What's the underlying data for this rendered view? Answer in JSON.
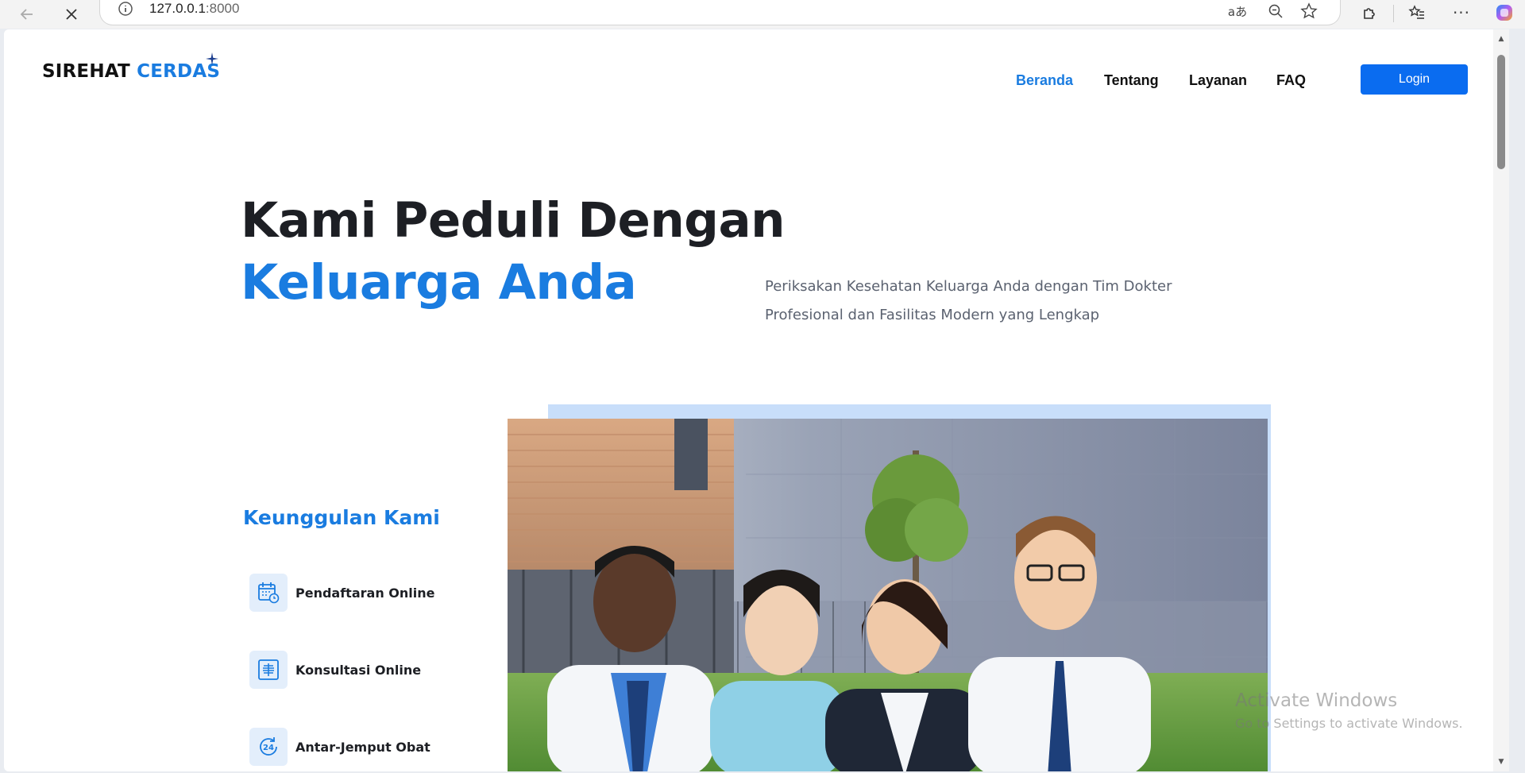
{
  "browser": {
    "url_host": "127.0.0.1",
    "url_port": ":8000"
  },
  "header": {
    "brand_part1": "SIREHAT",
    "brand_part2": "CERDAS",
    "nav": [
      "Beranda",
      "Tentang",
      "Layanan",
      "FAQ"
    ],
    "login_label": "Login"
  },
  "hero": {
    "line1": "Kami Peduli Dengan",
    "line2": "Keluarga Anda",
    "description_line1": "Periksakan Kesehatan Keluarga Anda dengan Tim Dokter",
    "description_line2": "Profesional dan Fasilitas Modern yang Lengkap"
  },
  "advantages": {
    "title": "Keunggulan Kami",
    "items": [
      {
        "label": "Pendaftaran Online",
        "icon": "calendar-clock-icon"
      },
      {
        "label": "Konsultasi Online",
        "icon": "xray-icon"
      },
      {
        "label": "Antar-Jemput Obat",
        "icon": "24-hour-icon"
      }
    ]
  },
  "watermark": {
    "line1": "Activate Windows",
    "line2": "Go to Settings to activate Windows."
  },
  "colors": {
    "accent": "#1a7ce0",
    "login_button": "#0a6cf0",
    "image_backdrop": "#c8defa"
  }
}
